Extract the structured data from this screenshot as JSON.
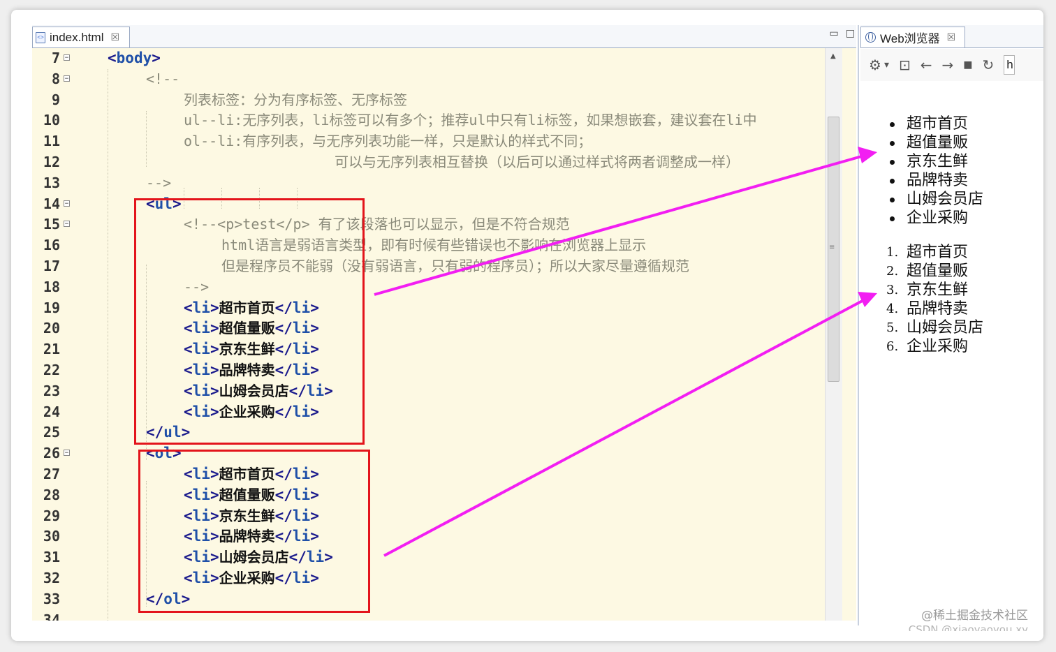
{
  "editor": {
    "tab_label": "index.html",
    "tab_close": "☒",
    "minimize": "▭",
    "maximize": "□",
    "lines": [
      {
        "num": "7",
        "fold": true,
        "segments": [
          {
            "t": "tag",
            "v": "<"
          },
          {
            "t": "name",
            "v": "body"
          },
          {
            "t": "tag",
            "v": ">"
          }
        ]
      },
      {
        "num": "8",
        "fold": true,
        "segments": [
          {
            "t": "cmt",
            "v": "<!--"
          }
        ]
      },
      {
        "num": "9",
        "segments": [
          {
            "t": "cmt",
            "v": "列表标签：分为有序标签、无序标签"
          }
        ]
      },
      {
        "num": "10",
        "segments": [
          {
            "t": "cmt",
            "v": "ul--li:无序列表，li标签可以有多个；推荐ul中只有li标签，如果想嵌套，建议套在li中"
          }
        ]
      },
      {
        "num": "11",
        "segments": [
          {
            "t": "cmt",
            "v": "ol--li:有序列表，与无序列表功能一样，只是默认的样式不同；"
          }
        ]
      },
      {
        "num": "12",
        "segments": [
          {
            "t": "cmt",
            "v": "可以与无序列表相互替换（以后可以通过样式将两者调整成一样）"
          }
        ]
      },
      {
        "num": "13",
        "segments": [
          {
            "t": "cmt",
            "v": "-->"
          }
        ]
      },
      {
        "num": "14",
        "fold": true,
        "segments": [
          {
            "t": "tag",
            "v": "<"
          },
          {
            "t": "name",
            "v": "ul"
          },
          {
            "t": "tag",
            "v": ">"
          }
        ]
      },
      {
        "num": "15",
        "fold": true,
        "segments": [
          {
            "t": "cmt",
            "v": "<!--<p>test</p> 有了该段落也可以显示，但是不符合规范"
          }
        ]
      },
      {
        "num": "16",
        "segments": [
          {
            "t": "cmt",
            "v": "html语言是弱语言类型，即有时候有些错误也不影响在浏览器上显示"
          }
        ]
      },
      {
        "num": "17",
        "segments": [
          {
            "t": "cmt",
            "v": "但是程序员不能弱（没有弱语言，只有弱的程序员）；所以大家尽量遵循规范"
          }
        ]
      },
      {
        "num": "18",
        "segments": [
          {
            "t": "cmt",
            "v": "-->"
          }
        ]
      },
      {
        "num": "19",
        "segments": [
          {
            "t": "tag",
            "v": "<"
          },
          {
            "t": "name",
            "v": "li"
          },
          {
            "t": "tag",
            "v": ">"
          },
          {
            "t": "text",
            "v": "超市首页"
          },
          {
            "t": "tag",
            "v": "</"
          },
          {
            "t": "name",
            "v": "li"
          },
          {
            "t": "tag",
            "v": ">"
          }
        ]
      },
      {
        "num": "20",
        "segments": [
          {
            "t": "tag",
            "v": "<"
          },
          {
            "t": "name",
            "v": "li"
          },
          {
            "t": "tag",
            "v": ">"
          },
          {
            "t": "text",
            "v": "超值量贩"
          },
          {
            "t": "tag",
            "v": "</"
          },
          {
            "t": "name",
            "v": "li"
          },
          {
            "t": "tag",
            "v": ">"
          }
        ]
      },
      {
        "num": "21",
        "segments": [
          {
            "t": "tag",
            "v": "<"
          },
          {
            "t": "name",
            "v": "li"
          },
          {
            "t": "tag",
            "v": ">"
          },
          {
            "t": "text",
            "v": "京东生鲜"
          },
          {
            "t": "tag",
            "v": "</"
          },
          {
            "t": "name",
            "v": "li"
          },
          {
            "t": "tag",
            "v": ">"
          }
        ]
      },
      {
        "num": "22",
        "segments": [
          {
            "t": "tag",
            "v": "<"
          },
          {
            "t": "name",
            "v": "li"
          },
          {
            "t": "tag",
            "v": ">"
          },
          {
            "t": "text",
            "v": "品牌特卖"
          },
          {
            "t": "tag",
            "v": "</"
          },
          {
            "t": "name",
            "v": "li"
          },
          {
            "t": "tag",
            "v": ">"
          }
        ]
      },
      {
        "num": "23",
        "segments": [
          {
            "t": "tag",
            "v": "<"
          },
          {
            "t": "name",
            "v": "li"
          },
          {
            "t": "tag",
            "v": ">"
          },
          {
            "t": "text",
            "v": "山姆会员店"
          },
          {
            "t": "tag",
            "v": "</"
          },
          {
            "t": "name",
            "v": "li"
          },
          {
            "t": "tag",
            "v": ">"
          }
        ]
      },
      {
        "num": "24",
        "segments": [
          {
            "t": "tag",
            "v": "<"
          },
          {
            "t": "name",
            "v": "li"
          },
          {
            "t": "tag",
            "v": ">"
          },
          {
            "t": "text",
            "v": "企业采购"
          },
          {
            "t": "tag",
            "v": "</"
          },
          {
            "t": "name",
            "v": "li"
          },
          {
            "t": "tag",
            "v": ">"
          }
        ]
      },
      {
        "num": "25",
        "segments": [
          {
            "t": "tag",
            "v": "</"
          },
          {
            "t": "name",
            "v": "ul"
          },
          {
            "t": "tag",
            "v": ">"
          }
        ]
      },
      {
        "num": "26",
        "fold": true,
        "segments": [
          {
            "t": "tag",
            "v": "<"
          },
          {
            "t": "name",
            "v": "ol"
          },
          {
            "t": "tag",
            "v": ">"
          }
        ]
      },
      {
        "num": "27",
        "segments": [
          {
            "t": "tag",
            "v": "<"
          },
          {
            "t": "name",
            "v": "li"
          },
          {
            "t": "tag",
            "v": ">"
          },
          {
            "t": "text",
            "v": "超市首页"
          },
          {
            "t": "tag",
            "v": "</"
          },
          {
            "t": "name",
            "v": "li"
          },
          {
            "t": "tag",
            "v": ">"
          }
        ]
      },
      {
        "num": "28",
        "segments": [
          {
            "t": "tag",
            "v": "<"
          },
          {
            "t": "name",
            "v": "li"
          },
          {
            "t": "tag",
            "v": ">"
          },
          {
            "t": "text",
            "v": "超值量贩"
          },
          {
            "t": "tag",
            "v": "</"
          },
          {
            "t": "name",
            "v": "li"
          },
          {
            "t": "tag",
            "v": ">"
          }
        ]
      },
      {
        "num": "29",
        "segments": [
          {
            "t": "tag",
            "v": "<"
          },
          {
            "t": "name",
            "v": "li"
          },
          {
            "t": "tag",
            "v": ">"
          },
          {
            "t": "text",
            "v": "京东生鲜"
          },
          {
            "t": "tag",
            "v": "</"
          },
          {
            "t": "name",
            "v": "li"
          },
          {
            "t": "tag",
            "v": ">"
          }
        ]
      },
      {
        "num": "30",
        "segments": [
          {
            "t": "tag",
            "v": "<"
          },
          {
            "t": "name",
            "v": "li"
          },
          {
            "t": "tag",
            "v": ">"
          },
          {
            "t": "text",
            "v": "品牌特卖"
          },
          {
            "t": "tag",
            "v": "</"
          },
          {
            "t": "name",
            "v": "li"
          },
          {
            "t": "tag",
            "v": ">"
          }
        ]
      },
      {
        "num": "31",
        "segments": [
          {
            "t": "tag",
            "v": "<"
          },
          {
            "t": "name",
            "v": "li"
          },
          {
            "t": "tag",
            "v": ">"
          },
          {
            "t": "text",
            "v": "山姆会员店"
          },
          {
            "t": "tag",
            "v": "</"
          },
          {
            "t": "name",
            "v": "li"
          },
          {
            "t": "tag",
            "v": ">"
          }
        ]
      },
      {
        "num": "32",
        "segments": [
          {
            "t": "tag",
            "v": "<"
          },
          {
            "t": "name",
            "v": "li"
          },
          {
            "t": "tag",
            "v": ">"
          },
          {
            "t": "text",
            "v": "企业采购"
          },
          {
            "t": "tag",
            "v": "</"
          },
          {
            "t": "name",
            "v": "li"
          },
          {
            "t": "tag",
            "v": ">"
          }
        ]
      },
      {
        "num": "33",
        "segments": [
          {
            "t": "tag",
            "v": "</"
          },
          {
            "t": "name",
            "v": "ol"
          },
          {
            "t": "tag",
            "v": ">"
          }
        ]
      },
      {
        "num": "34",
        "segments": []
      }
    ]
  },
  "browser": {
    "tab_label": "Web浏览器",
    "tab_close": "☒",
    "toolbar": {
      "settings": "⚙",
      "dropdown": "▾",
      "console": "⊡",
      "back": "←",
      "forward": "→",
      "stop": "■",
      "refresh": "↻",
      "address": "h"
    },
    "unordered_list": [
      "超市首页",
      "超值量贩",
      "京东生鲜",
      "品牌特卖",
      "山姆会员店",
      "企业采购"
    ],
    "ordered_list": [
      {
        "marker": "1.",
        "text": "超市首页"
      },
      {
        "marker": "2.",
        "text": "超值量贩"
      },
      {
        "marker": "3.",
        "text": "京东生鲜"
      },
      {
        "marker": "4.",
        "text": "品牌特卖"
      },
      {
        "marker": "5.",
        "text": "山姆会员店"
      },
      {
        "marker": "6.",
        "text": "企业采购"
      }
    ]
  },
  "annotation_colors": {
    "box": "#e3141b",
    "arrow": "#f21ef2"
  },
  "watermark": {
    "line1": "@稀土掘金技术社区",
    "line2": "CSDN @xiaoyaoyou.xy"
  }
}
